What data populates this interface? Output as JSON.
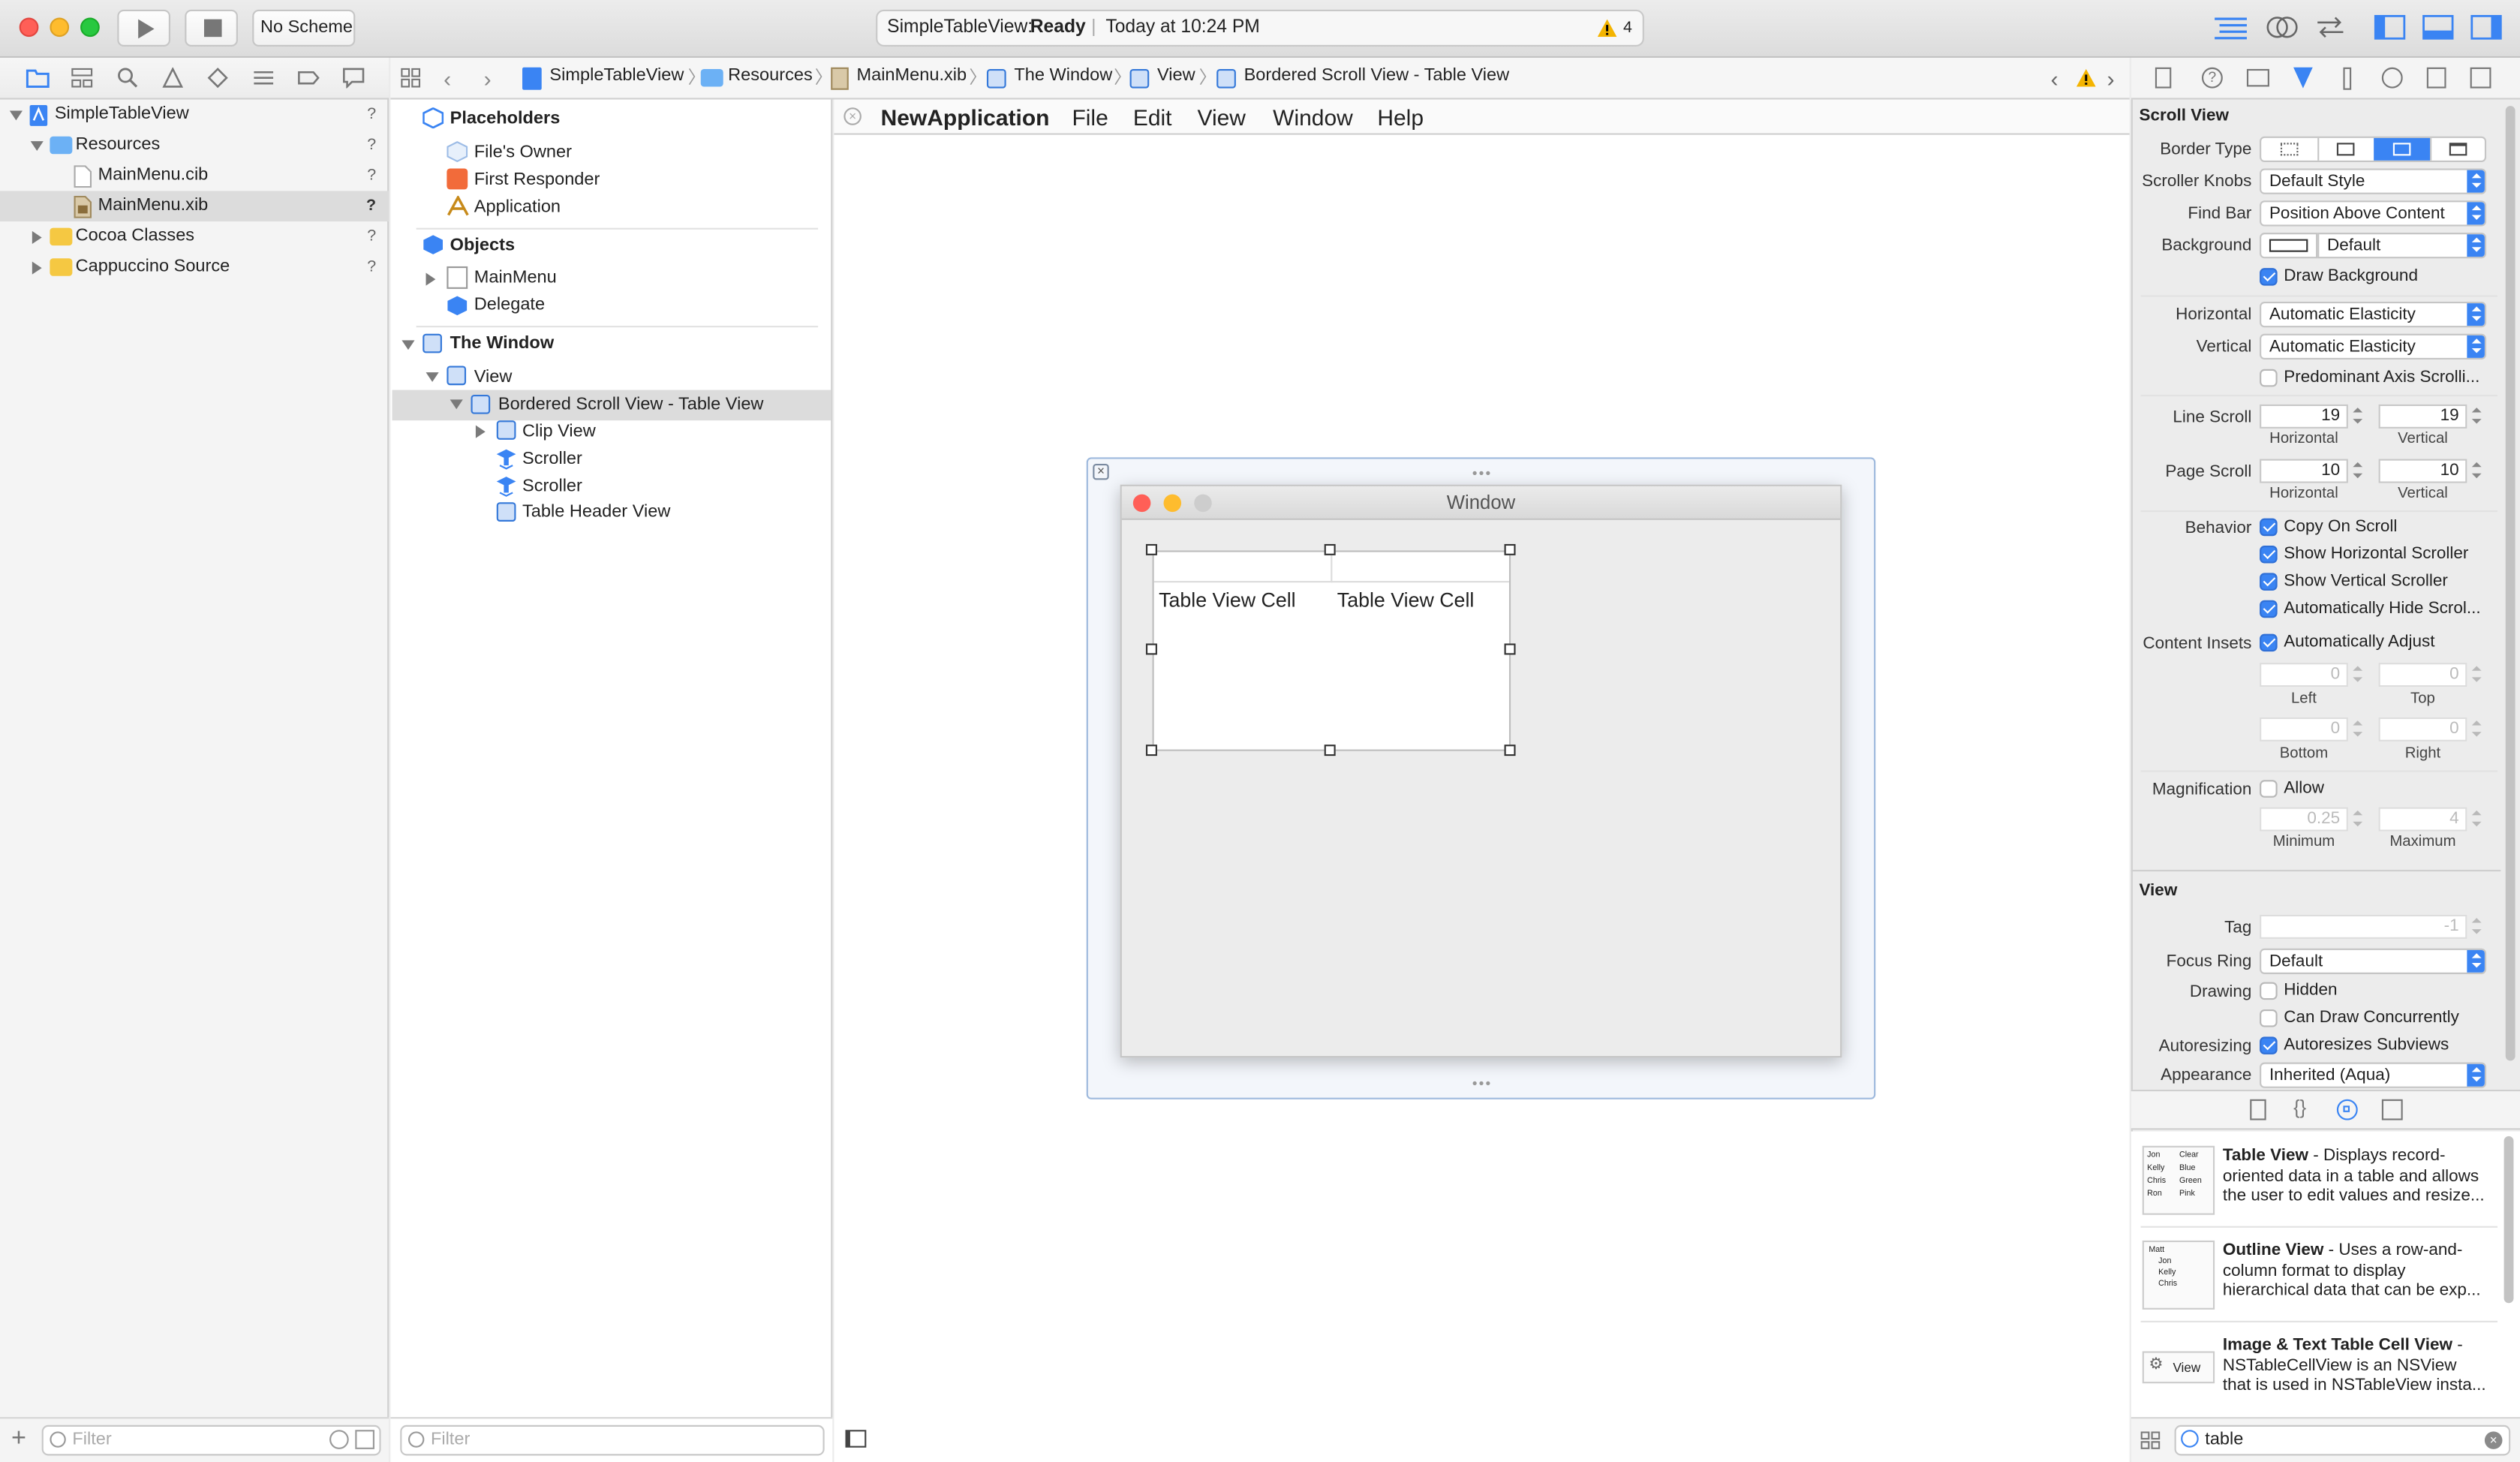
{
  "toolbar": {
    "scheme": "No Scheme",
    "status_project": "SimpleTableView:",
    "status_state": "Ready",
    "status_time": "Today at 10:24 PM",
    "warning_count": "4"
  },
  "navigator": {
    "items": [
      {
        "label": "SimpleTableView",
        "badge": "?"
      },
      {
        "label": "Resources",
        "badge": "?"
      },
      {
        "label": "MainMenu.cib",
        "badge": "?"
      },
      {
        "label": "MainMenu.xib",
        "badge": "?"
      },
      {
        "label": "Cocoa Classes",
        "badge": "?"
      },
      {
        "label": "Cappuccino Source",
        "badge": "?"
      }
    ],
    "filter_placeholder": "Filter"
  },
  "breadcrumb": [
    "SimpleTableView",
    "Resources",
    "MainMenu.xib",
    "The Window",
    "View",
    "Bordered Scroll View - Table View"
  ],
  "outline": {
    "placeholders_title": "Placeholders",
    "placeholders": [
      "File's Owner",
      "First Responder",
      "Application"
    ],
    "objects_title": "Objects",
    "objects": [
      "MainMenu",
      "Delegate"
    ],
    "window_title": "The Window",
    "view": "View",
    "scroll_view": "Bordered Scroll View - Table View",
    "children": [
      "Clip View",
      "Scroller",
      "Scroller",
      "Table Header View"
    ],
    "filter_placeholder": "Filter"
  },
  "canvas": {
    "app_name": "NewApplication",
    "menu": [
      "File",
      "Edit",
      "View",
      "Window",
      "Help"
    ],
    "window_title": "Window",
    "cells": [
      "Table View Cell",
      "Table View Cell"
    ]
  },
  "inspector": {
    "scroll_title": "Scroll View",
    "border_type_label": "Border Type",
    "scroller_knobs_label": "Scroller Knobs",
    "scroller_knobs": "Default Style",
    "find_bar_label": "Find Bar",
    "find_bar": "Position Above Content",
    "background_label": "Background",
    "background": "Default",
    "draw_background": "Draw Background",
    "horizontal_label": "Horizontal",
    "horizontal": "Automatic Elasticity",
    "vertical_label": "Vertical",
    "vertical": "Automatic Elasticity",
    "predominant": "Predominant Axis Scrolli...",
    "line_scroll_label": "Line Scroll",
    "line_scroll_h": "19",
    "line_scroll_v": "19",
    "page_scroll_label": "Page Scroll",
    "page_scroll_h": "10",
    "page_scroll_v": "10",
    "sub_horizontal": "Horizontal",
    "sub_vertical": "Vertical",
    "behavior_label": "Behavior",
    "behaviors": [
      "Copy On Scroll",
      "Show Horizontal Scroller",
      "Show Vertical Scroller",
      "Automatically Hide Scrol..."
    ],
    "content_insets_label": "Content Insets",
    "auto_adjust": "Automatically Adjust",
    "insets": {
      "left": "0",
      "top": "0",
      "bottom": "0",
      "right": "0"
    },
    "sub_left": "Left",
    "sub_top": "Top",
    "sub_bottom": "Bottom",
    "sub_right": "Right",
    "magnification_label": "Magnification",
    "allow": "Allow",
    "mag_min": "0.25",
    "mag_max": "4",
    "sub_minimum": "Minimum",
    "sub_maximum": "Maximum",
    "view_title": "View",
    "tag_label": "Tag",
    "tag": "-1",
    "focus_ring_label": "Focus Ring",
    "focus_ring": "Default",
    "drawing_label": "Drawing",
    "hidden": "Hidden",
    "can_draw": "Can Draw Concurrently",
    "autoresizing_label": "Autoresizing",
    "autoresizes": "Autoresizes Subviews",
    "appearance_label": "Appearance",
    "appearance": "Inherited (Aqua)"
  },
  "library": {
    "items": [
      {
        "title": "Table View",
        "desc": " - Displays record-oriented data in a table and allows the user to edit values and resize..."
      },
      {
        "title": "Outline View",
        "desc": " - Uses a row-and-column format to display hierarchical data that can be exp..."
      },
      {
        "title": "Image & Text Table Cell View",
        "desc": " - NSTableCellView is an NSView that is used in NSTableView insta..."
      }
    ],
    "thumb_table": [
      "Jon",
      "Clear",
      "Kelly",
      "Blue",
      "Chris",
      "Green",
      "Ron",
      "Pink"
    ],
    "thumb_outline": [
      "Matt",
      "Jon",
      "Kelly",
      "Chris"
    ],
    "thumb_view": "View",
    "search": "table"
  },
  "colors": {
    "accent": "#3a84f3",
    "close": "#ff5f57",
    "minimize": "#febc2e",
    "zoom": "#28c840",
    "folder": "#f5c842",
    "warning": "#f4b400"
  }
}
